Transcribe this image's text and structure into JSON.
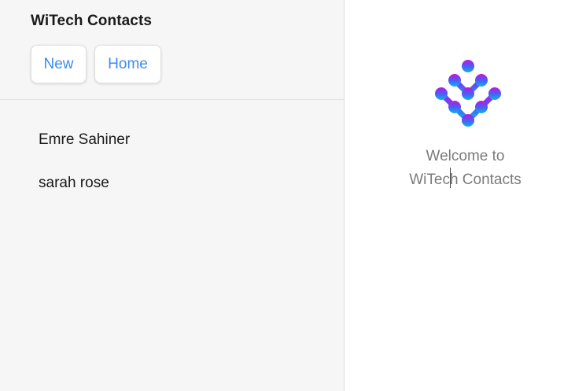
{
  "app": {
    "title": "WiTech Contacts"
  },
  "toolbar": {
    "new_label": "New",
    "home_label": "Home",
    "accent_color": "#3c8cf0"
  },
  "contacts": [
    {
      "name": "Emre Sahiner"
    },
    {
      "name": "sarah rose"
    }
  ],
  "welcome": {
    "line1": "Welcome to",
    "line2": "WiTech Contacts"
  },
  "logo": {
    "icon": "witech-logo-icon",
    "gradient": [
      "#c21bd9",
      "#7a3df0",
      "#3b6cf2",
      "#13b3ea"
    ]
  }
}
